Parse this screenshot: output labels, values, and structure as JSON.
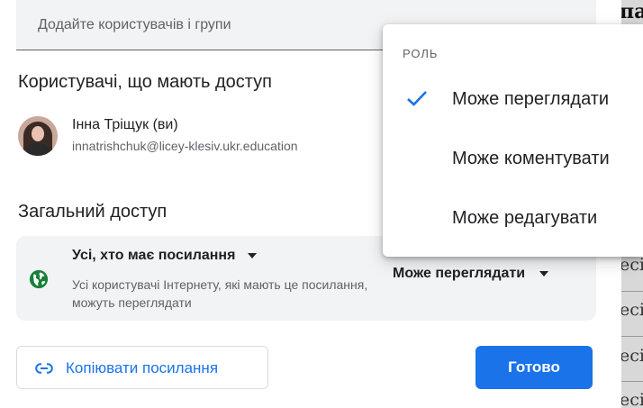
{
  "add_people": {
    "placeholder": "Додайте користувачів і групи"
  },
  "people_with_access": {
    "title": "Користувачі, що мають доступ",
    "users": [
      {
        "name": "Інна Тріщук (ви)",
        "email": "innatrishchuk@licey-klesiv.ukr.education"
      }
    ]
  },
  "general_access": {
    "title": "Загальний доступ",
    "link_type": "Усі, хто має посилання",
    "description": "Усі користувачі Інтернету, які мають це посилання, можуть переглядати",
    "role": "Може переглядати"
  },
  "buttons": {
    "copy_link": "Копіювати посилання",
    "done": "Готово"
  },
  "role_menu": {
    "header": "РОЛЬ",
    "items": [
      {
        "label": "Може переглядати",
        "selected": true
      },
      {
        "label": "Може коментувати",
        "selected": false
      },
      {
        "label": "Може редагувати",
        "selected": false
      }
    ]
  },
  "background_doc": {
    "top_text": "па",
    "side_texts": [
      "есі",
      "есі",
      "есі",
      "есі"
    ]
  },
  "colors": {
    "accent": "#1a73e8",
    "globe": "#188038",
    "field_bg": "#f1f3f4",
    "text": "#202124",
    "muted": "#5f6368"
  }
}
